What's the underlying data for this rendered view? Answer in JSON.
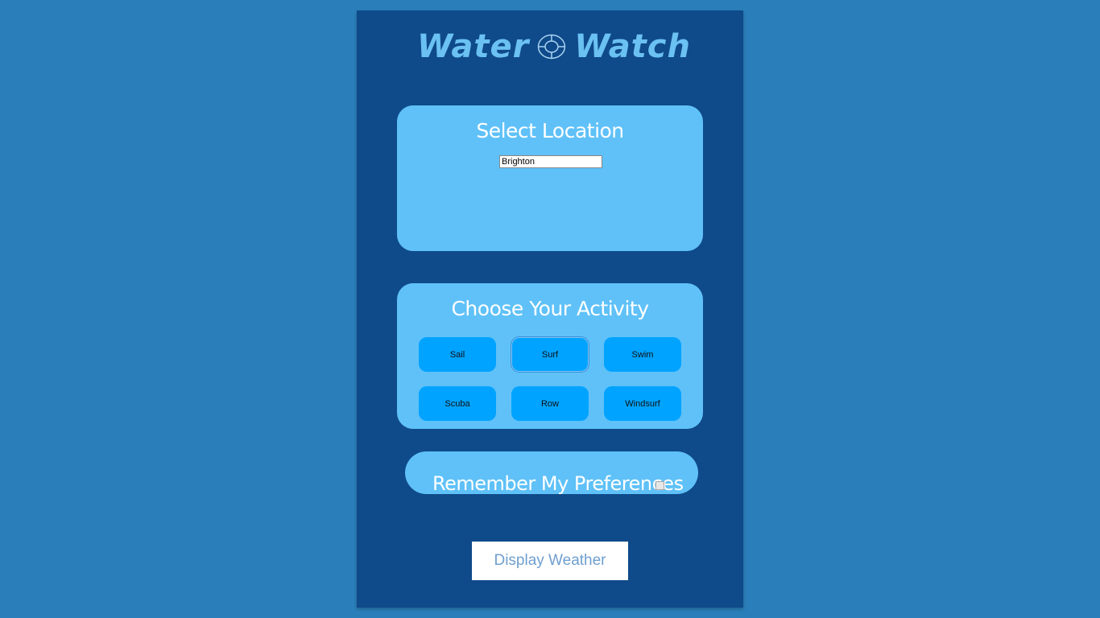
{
  "logo": {
    "left_word": "Water",
    "right_word": "Watch",
    "icon": "lifebuoy-icon",
    "color": "#6ac1f2"
  },
  "location": {
    "title": "Select Location",
    "input_value": "Brighton"
  },
  "activity": {
    "title": "Choose Your Activity",
    "selected": "Surf",
    "buttons": [
      "Sail",
      "Surf",
      "Swim",
      "Scuba",
      "Row",
      "Windsurf"
    ]
  },
  "preferences": {
    "label": "Remember My Preferences",
    "checked": false
  },
  "action": {
    "display_label": "Display Weather"
  },
  "colors": {
    "page_bg": "#2a7fba",
    "panel_bg": "#0f4a8a",
    "card_bg": "#5fc1f8",
    "button_bg": "#00a3ff"
  }
}
